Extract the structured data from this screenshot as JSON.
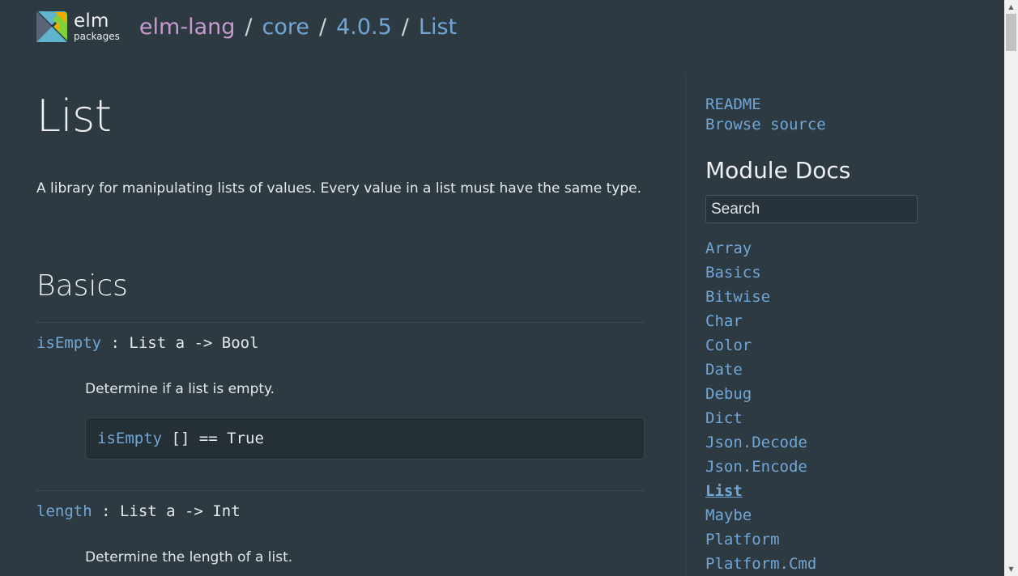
{
  "header": {
    "logo_elm": "elm",
    "logo_packages": "packages",
    "breadcrumb": {
      "user": "elm-lang",
      "package": "core",
      "version": "4.0.5",
      "module": "List",
      "separator": "/"
    }
  },
  "main": {
    "title": "List",
    "description": "A library for manipulating lists of values. Every value in a list must have the same type.",
    "section_title": "Basics",
    "entries": [
      {
        "name": "isEmpty",
        "signature": " : List a -> Bool",
        "doc": "Determine if a list is empty.",
        "example_fn": "isEmpty",
        "example_rest": " [] == True"
      },
      {
        "name": "length",
        "signature": " : List a -> Int",
        "doc": "Determine the length of a list."
      }
    ]
  },
  "sidebar": {
    "readme": "README",
    "browse_source": "Browse source",
    "heading": "Module Docs",
    "search_placeholder": "Search",
    "modules": [
      "Array",
      "Basics",
      "Bitwise",
      "Char",
      "Color",
      "Date",
      "Debug",
      "Dict",
      "Json.Decode",
      "Json.Encode",
      "List",
      "Maybe",
      "Platform",
      "Platform.Cmd"
    ],
    "active_module": "List"
  },
  "colors": {
    "background": "#2d3a42",
    "link": "#72a6d6",
    "user": "#c89bd0",
    "text": "#e8eaeb"
  },
  "icons": {
    "logo": "elm-tangram-logo",
    "cursor": "text-cursor-icon"
  }
}
